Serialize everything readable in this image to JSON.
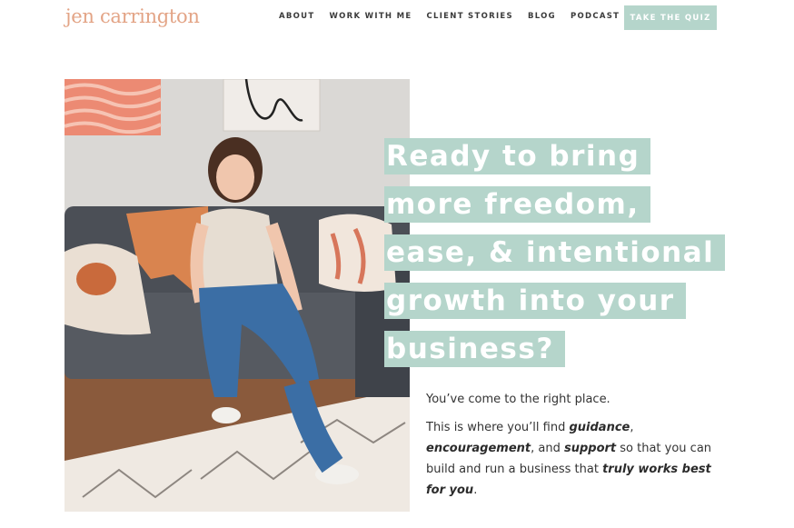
{
  "brand": {
    "logo_text": "jen carrington",
    "accent": "#e3a486",
    "mint": "#b5d5cb"
  },
  "nav": {
    "items": [
      "ABOUT",
      "WORK WITH ME",
      "CLIENT STORIES",
      "BLOG",
      "PODCAST"
    ],
    "cta": "TAKE THE QUIZ"
  },
  "hero": {
    "headline_lines": [
      "Ready to bring",
      "more freedom,",
      "ease, & intentional",
      "growth into your",
      "business?"
    ],
    "intro": "You’ve come to the right place.",
    "body": {
      "t1": "This is where you’ll find ",
      "b1": "guidance",
      "t2": ",",
      "b2": "encouragement",
      "t3": ", and ",
      "b3": "support",
      "t4": " so that you can build and run a business that ",
      "b4": "truly works best for you",
      "t5": "."
    }
  }
}
